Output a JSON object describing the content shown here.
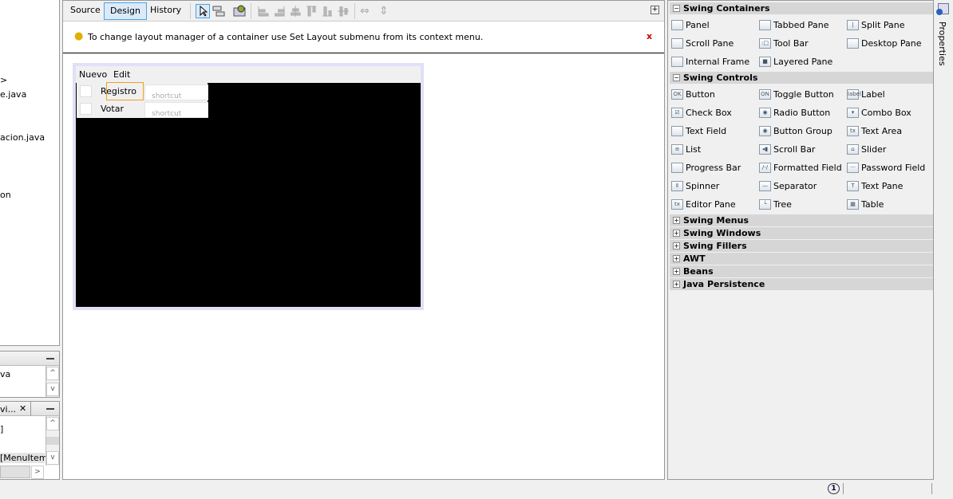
{
  "left_tree": {
    "lines": [
      ">",
      "e.java",
      "acion.java",
      "on"
    ]
  },
  "navigator": {
    "line": "va"
  },
  "inspector": {
    "tab": "vi...",
    "lines": [
      "]",
      "[MenuItem]"
    ]
  },
  "editor": {
    "tabs": [
      {
        "label": "Source"
      },
      {
        "label": "Design",
        "selected": true
      },
      {
        "label": "History"
      }
    ],
    "toolbar_icons": [
      "selection-mode-icon",
      "connection-mode-icon",
      "preview-design-icon",
      "align-left-icon",
      "align-right-icon",
      "center-horizontal-icon",
      "align-top-icon",
      "align-bottom-icon",
      "center-vertical-icon",
      "resize-horizontal-icon",
      "resize-vertical-icon"
    ],
    "info": "To change layout manager of a container use Set Layout submenu from its context menu.",
    "close": "x",
    "form": {
      "menus": [
        "Nuevo",
        "Edit"
      ],
      "items": [
        {
          "label": "Registro",
          "shortcut": "shortcut"
        },
        {
          "label": "Votar",
          "shortcut": "shortcut"
        }
      ]
    }
  },
  "palette": {
    "sections": [
      {
        "title": "Swing Containers",
        "expanded": true,
        "items": [
          {
            "label": "Panel",
            "icon": ""
          },
          {
            "label": "Tabbed Pane",
            "icon": ""
          },
          {
            "label": "Split Pane",
            "icon": "|"
          },
          {
            "label": "Scroll Pane",
            "icon": ""
          },
          {
            "label": "Tool Bar",
            "icon": ":□"
          },
          {
            "label": "Desktop Pane",
            "icon": ""
          },
          {
            "label": "Internal Frame",
            "icon": ""
          },
          {
            "label": "Layered Pane",
            "icon": "■"
          }
        ]
      },
      {
        "title": "Swing Controls",
        "expanded": true,
        "items": [
          {
            "label": "Button",
            "icon": "OK"
          },
          {
            "label": "Toggle Button",
            "icon": "ON"
          },
          {
            "label": "Label",
            "icon": "label"
          },
          {
            "label": "Check Box",
            "icon": "☑"
          },
          {
            "label": "Radio Button",
            "icon": "◉"
          },
          {
            "label": "Combo Box",
            "icon": "▾"
          },
          {
            "label": "Text Field",
            "icon": ""
          },
          {
            "label": "Button Group",
            "icon": "◉"
          },
          {
            "label": "Text Area",
            "icon": "tx"
          },
          {
            "label": "List",
            "icon": "≡"
          },
          {
            "label": "Scroll Bar",
            "icon": "◂▮"
          },
          {
            "label": "Slider",
            "icon": "⌂"
          },
          {
            "label": "Progress Bar",
            "icon": ""
          },
          {
            "label": "Formatted Field",
            "icon": "/-/"
          },
          {
            "label": "Password Field",
            "icon": "···"
          },
          {
            "label": "Spinner",
            "icon": "⇕"
          },
          {
            "label": "Separator",
            "icon": "—"
          },
          {
            "label": "Text Pane",
            "icon": "T"
          },
          {
            "label": "Editor Pane",
            "icon": "tx"
          },
          {
            "label": "Tree",
            "icon": "└"
          },
          {
            "label": "Table",
            "icon": "▦"
          }
        ]
      },
      {
        "title": "Swing Menus",
        "expanded": false
      },
      {
        "title": "Swing Windows",
        "expanded": false
      },
      {
        "title": "Swing Fillers",
        "expanded": false
      },
      {
        "title": "AWT",
        "expanded": false
      },
      {
        "title": "Beans",
        "expanded": false
      },
      {
        "title": "Java Persistence",
        "expanded": false
      }
    ]
  },
  "properties_tab": "Properties",
  "status": {
    "notifications": "1"
  }
}
